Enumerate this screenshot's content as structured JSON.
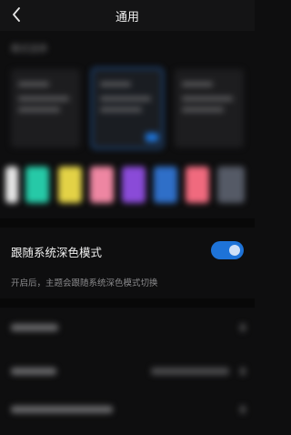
{
  "header": {
    "title": "通用",
    "back_icon": "chevron-left-icon"
  },
  "sections": {
    "mode_label": "模式选择",
    "follow_system_label": "跟随系统深色模式",
    "follow_system_enabled": true,
    "follow_system_desc": "开启后，主题会跟随系统深色模式切换"
  },
  "colors": {
    "accent": "#1e73d8",
    "background": "#0e0e0f",
    "swatches": [
      "#e6e6e6",
      "#26c9a7",
      "#e3d246",
      "#ee86a2",
      "#8a4bd8",
      "#2f6fc8",
      "#f06a7e",
      "#555a66"
    ]
  }
}
